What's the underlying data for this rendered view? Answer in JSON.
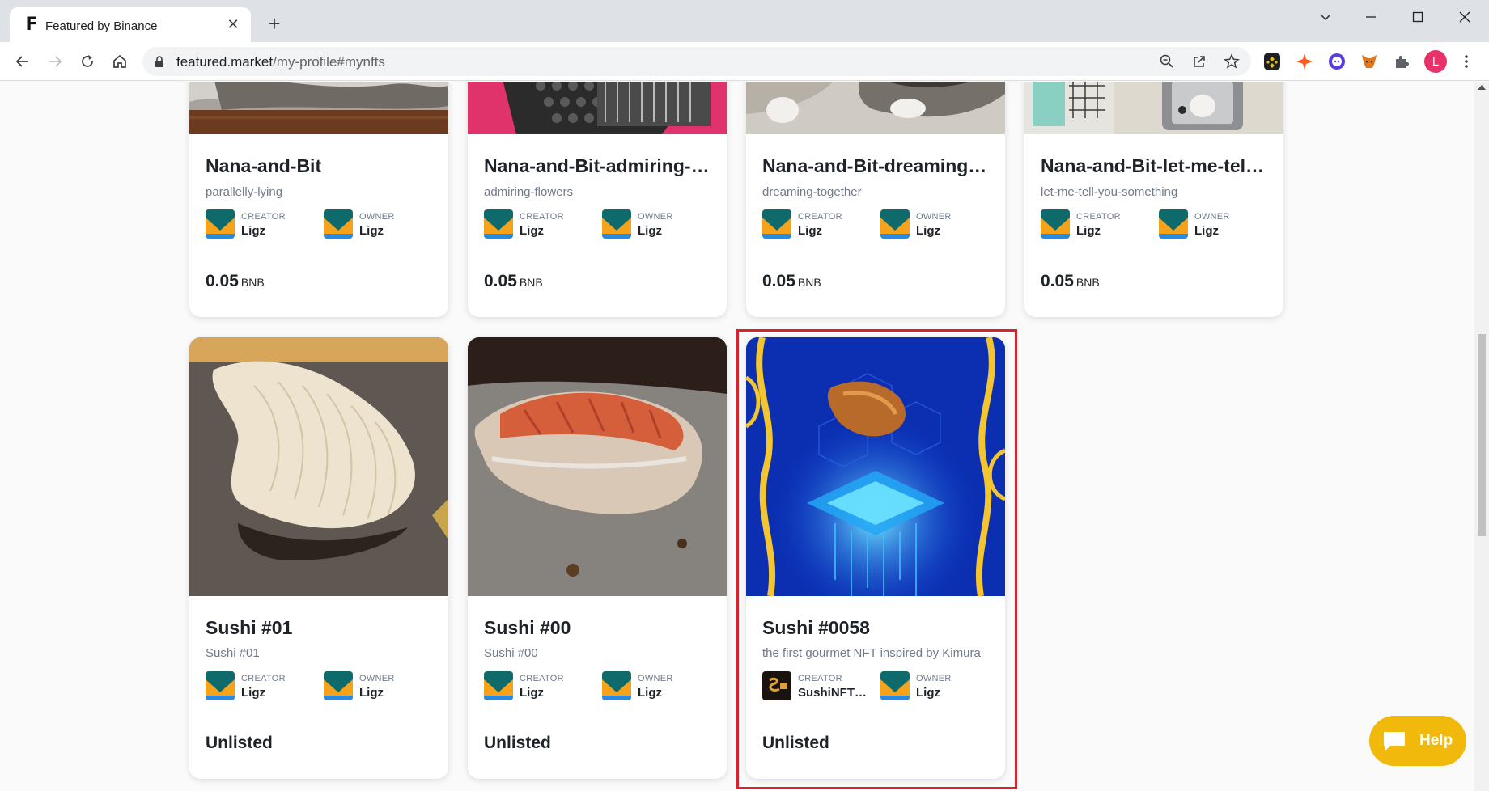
{
  "browser": {
    "tab_title": "Featured by Binance",
    "tab_favicon": "F",
    "new_tab": "+",
    "close_tab": "✕",
    "url_domain": "featured.market",
    "url_path": "/my-profile#mynfts",
    "profile_initial": "L"
  },
  "cards_row1": [
    {
      "title": "Nana-and-Bit",
      "desc": "parallelly-lying",
      "creator_label": "CREATOR",
      "creator": "Ligz",
      "owner_label": "OWNER",
      "owner": "Ligz",
      "price": "0.05",
      "currency": "BNB"
    },
    {
      "title": "Nana-and-Bit-admiring-flowers",
      "desc": "admiring-flowers",
      "creator_label": "CREATOR",
      "creator": "Ligz",
      "owner_label": "OWNER",
      "owner": "Ligz",
      "price": "0.05",
      "currency": "BNB"
    },
    {
      "title": "Nana-and-Bit-dreaming-together",
      "desc": "dreaming-together",
      "creator_label": "CREATOR",
      "creator": "Ligz",
      "owner_label": "OWNER",
      "owner": "Ligz",
      "price": "0.05",
      "currency": "BNB"
    },
    {
      "title": "Nana-and-Bit-let-me-tell-you-something",
      "desc": "let-me-tell-you-something",
      "creator_label": "CREATOR",
      "creator": "Ligz",
      "owner_label": "OWNER",
      "owner": "Ligz",
      "price": "0.05",
      "currency": "BNB"
    }
  ],
  "cards_row2": [
    {
      "title": "Sushi #01",
      "desc": "Sushi #01",
      "creator_label": "CREATOR",
      "creator": "Ligz",
      "owner_label": "OWNER",
      "owner": "Ligz",
      "status": "Unlisted"
    },
    {
      "title": "Sushi #00",
      "desc": "Sushi #00",
      "creator_label": "CREATOR",
      "creator": "Ligz",
      "owner_label": "OWNER",
      "owner": "Ligz",
      "status": "Unlisted"
    },
    {
      "title": "Sushi #0058",
      "desc": "the first gourmet NFT inspired by Kimura",
      "creator_label": "CREATOR",
      "creator": "SushiNFTS...",
      "owner_label": "OWNER",
      "owner": "Ligz",
      "status": "Unlisted"
    }
  ],
  "help": {
    "label": "Help"
  },
  "colors": {
    "accent": "#f0b90b",
    "highlight": "#d9222a"
  }
}
